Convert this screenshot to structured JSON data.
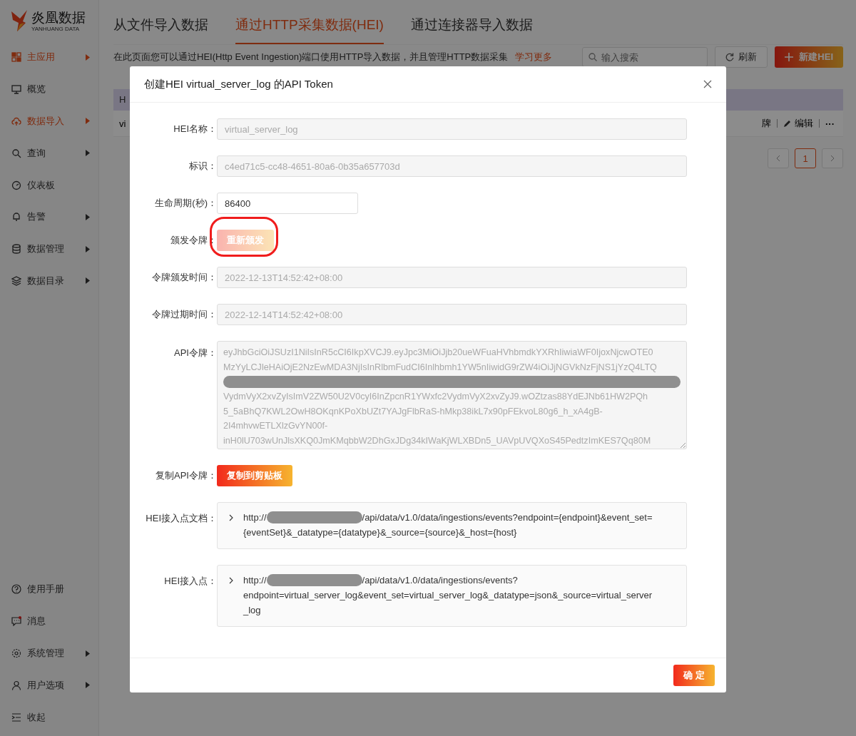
{
  "logo": {
    "name": "炎凰数据",
    "subtitle": "YANHUANG DATA"
  },
  "sidebar": {
    "items": [
      {
        "label": "主应用",
        "selected": true,
        "has_submenu": true
      },
      {
        "label": "概览",
        "selected": false,
        "has_submenu": false
      },
      {
        "label": "数据导入",
        "selected": true,
        "has_submenu": true
      },
      {
        "label": "查询",
        "selected": false,
        "has_submenu": true
      },
      {
        "label": "仪表板",
        "selected": false,
        "has_submenu": false
      },
      {
        "label": "告警",
        "selected": false,
        "has_submenu": true
      },
      {
        "label": "数据管理",
        "selected": false,
        "has_submenu": true
      },
      {
        "label": "数据目录",
        "selected": false,
        "has_submenu": true
      }
    ],
    "bottom_items": [
      {
        "label": "使用手册",
        "has_submenu": false,
        "badge": false
      },
      {
        "label": "消息",
        "has_submenu": false,
        "badge": true
      },
      {
        "label": "系统管理",
        "has_submenu": true,
        "badge": false
      },
      {
        "label": "用户选项",
        "has_submenu": true,
        "badge": false
      },
      {
        "label": "收起",
        "has_submenu": false,
        "badge": false
      }
    ]
  },
  "tabs": [
    {
      "label": "从文件导入数据",
      "selected": false
    },
    {
      "label": "通过HTTP采集数据(HEI)",
      "selected": true
    },
    {
      "label": "通过连接器导入数据",
      "selected": false
    }
  ],
  "description": "在此页面您可以通过HEI(Http Event Ingestion)端口使用HTTP导入数据，并且管理HTTP数据采集",
  "learn_more": "学习更多",
  "search": {
    "placeholder": "输入搜索"
  },
  "refresh_button": "刷新",
  "new_button": "新建HEI",
  "table": {
    "header": "H",
    "row": "vi",
    "actions": [
      "牌",
      "编辑",
      "···"
    ]
  },
  "pagination": {
    "pages": [
      {
        "label": "1",
        "selected": true
      }
    ]
  },
  "dialog": {
    "title": "创建HEI virtual_server_log 的API Token",
    "fields": [
      {
        "kind": "input",
        "label": "HEI名称：",
        "value": "virtual_server_log",
        "disabled": true
      },
      {
        "kind": "input",
        "label": "标识：",
        "value": "c4ed71c5-cc48-4651-80a6-0b35a657703d",
        "disabled": true
      },
      {
        "kind": "input",
        "label": "生命周期(秒)：",
        "value": "86400",
        "disabled": false,
        "short": true
      },
      {
        "kind": "button",
        "label": "颁发令牌：",
        "button": "重新颁发",
        "disabled": true,
        "highlighted": true
      },
      {
        "kind": "input",
        "label": "令牌颁发时间：",
        "value": "2022-12-13T14:52:42+08:00",
        "disabled": true
      },
      {
        "kind": "input",
        "label": "令牌过期时间：",
        "value": "2022-12-14T14:52:42+08:00",
        "disabled": true
      },
      {
        "kind": "token",
        "label": "API令牌：",
        "lines_before": [
          "eyJhbGciOiJSUzI1NiIsInR5cCI6IkpXVCJ9.eyJpc3MiOiJjb20ueWFuaHVhbmdkYXRhIiwiaWF0IjoxNjcwOTE0",
          "MzYyLCJleHAiOjE2NzEwMDA3NjIsInRlbmFudCI6Inlhbmh1YW5nIiwidG9rZW4iOiJjNGVkNzFjNS1jYzQ4LTQ"
        ],
        "lines_after": [
          "VydmVyX2xvZyIsImV2ZW50U2V0cyI6InZpcnR1YWxfc2VydmVyX2xvZyJ9.wOZtzas88YdEJNb61HW2PQh",
          "5_5aBhQ7KWL2OwH8OKqnKPoXbUZt7YAJgFlbRaS-hMkp38ikL7x90pFEkvoL80g6_h_xA4gB-",
          "2I4mhvwETLXlzGvYN00f-",
          "inH0lU703wUnJlsXKQ0JmKMqbbW2DhGxJDg34kIWaKjWLXBDn5_UAVpUVQXoS45PedtzImKES7Qq80M"
        ]
      },
      {
        "kind": "button",
        "label": "复制API令牌：",
        "button": "复制到剪贴板",
        "disabled": false,
        "highlighted": false
      },
      {
        "kind": "url",
        "label": "HEI接入点文档：",
        "prefix": "http://",
        "suffix": "/api/data/v1.0/data/ingestions/events?endpoint={endpoint}&event_set=",
        "more_lines": [
          "{eventSet}&_datatype={datatype}&_source={source}&_host={host}"
        ]
      },
      {
        "kind": "url",
        "label": "HEI接入点：",
        "prefix": "http://",
        "suffix": "/api/data/v1.0/data/ingestions/events?",
        "more_lines": [
          "endpoint=virtual_server_log&event_set=virtual_server_log&_datatype=json&_source=virtual_server",
          "_log"
        ]
      }
    ],
    "ok_button": "确 定"
  }
}
